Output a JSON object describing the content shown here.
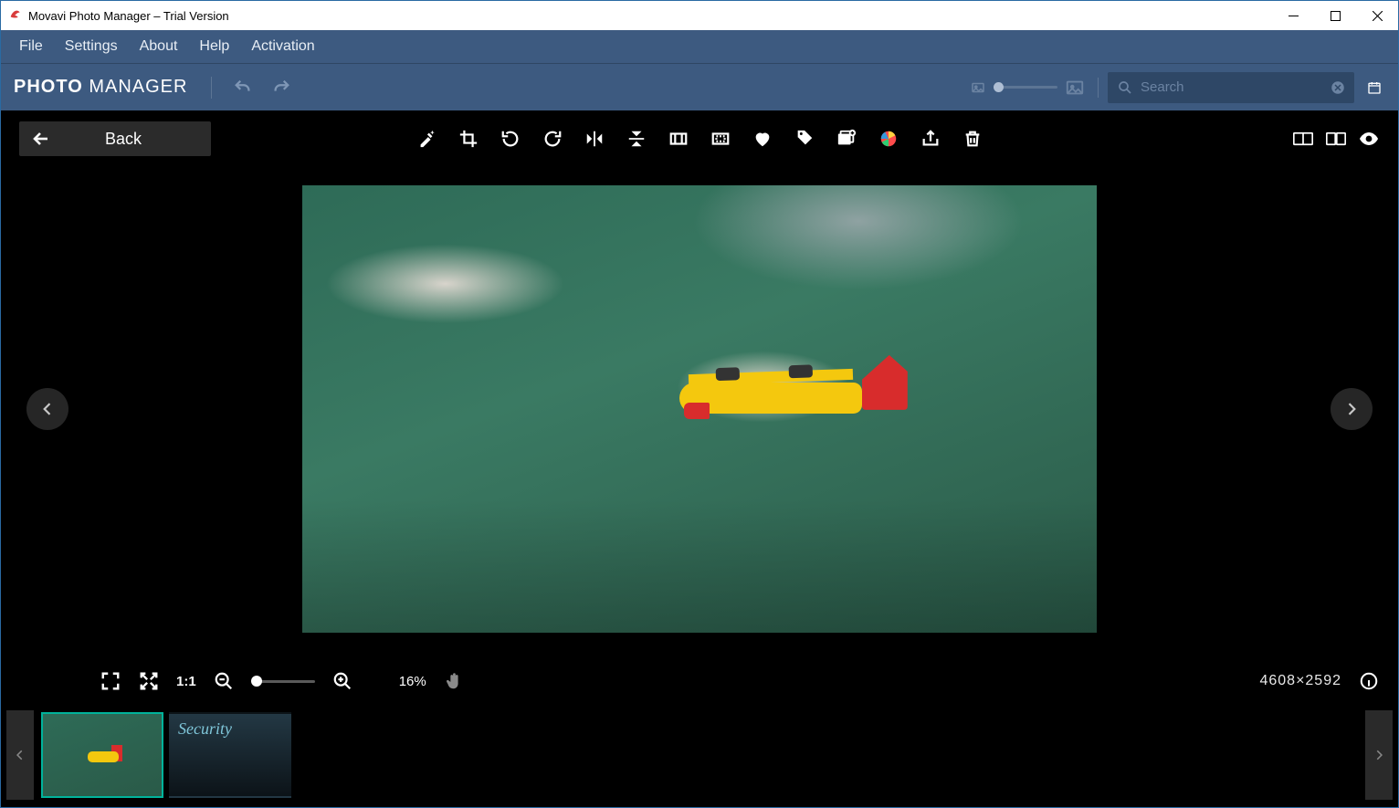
{
  "window": {
    "title": "Movavi Photo Manager – Trial Version"
  },
  "menubar": [
    "File",
    "Settings",
    "About",
    "Help",
    "Activation"
  ],
  "brand": {
    "bold": "PHOTO",
    "thin": " MANAGER"
  },
  "search": {
    "placeholder": "Search"
  },
  "viewer": {
    "back_label": "Back",
    "tools": [
      {
        "name": "auto-enhance-icon"
      },
      {
        "name": "crop-icon"
      },
      {
        "name": "rotate-left-icon"
      },
      {
        "name": "rotate-right-icon"
      },
      {
        "name": "flip-horizontal-icon"
      },
      {
        "name": "flip-vertical-icon"
      },
      {
        "name": "resize-icon"
      },
      {
        "name": "straighten-icon"
      },
      {
        "name": "favorite-icon"
      },
      {
        "name": "tag-icon"
      },
      {
        "name": "add-to-album-icon"
      },
      {
        "name": "edit-in-photo-editor-icon"
      },
      {
        "name": "export-icon"
      },
      {
        "name": "delete-icon"
      }
    ],
    "right_tools": [
      {
        "name": "before-after-icon"
      },
      {
        "name": "compare-icon"
      },
      {
        "name": "preview-icon"
      }
    ]
  },
  "zoom": {
    "one_to_one": "1:1",
    "percent": "16%",
    "dimensions": "4608×2592"
  },
  "filmstrip": {
    "thumbs": [
      {
        "name": "thumbnail-airplane",
        "selected": true
      },
      {
        "name": "thumbnail-security",
        "label": "Security",
        "selected": false
      }
    ]
  }
}
